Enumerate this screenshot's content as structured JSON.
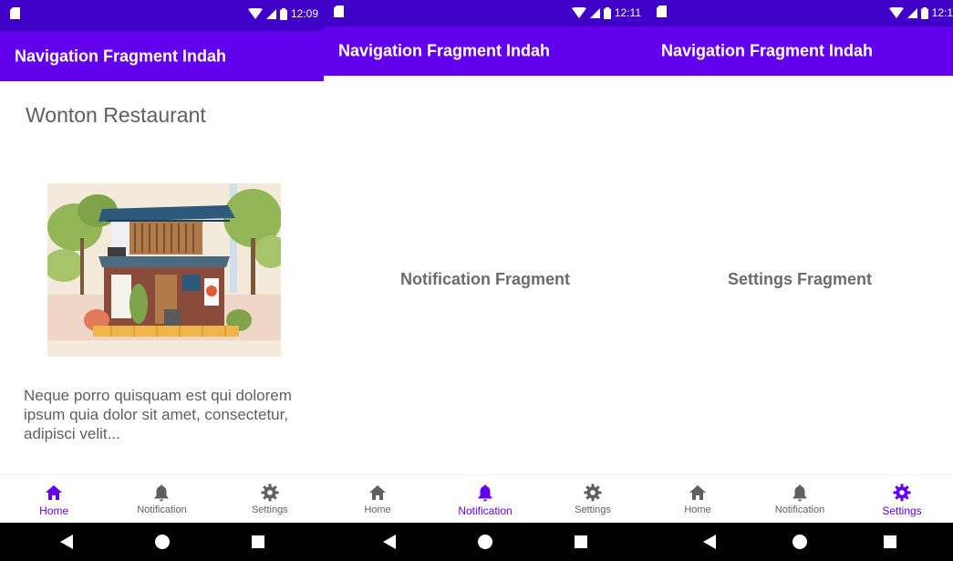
{
  "colors": {
    "status_bar": "#3f00c8",
    "app_bar": "#6200ee",
    "active_nav": "#6200ee",
    "inactive_nav": "#5f5f5f",
    "text_primary": "#5f5f5f",
    "system_nav": "#000000"
  },
  "screens": [
    {
      "status": {
        "time": "12:09",
        "sim_icon": "sim-card-icon",
        "wifi_icon": "wifi-icon",
        "signal_icon": "signal-icon",
        "battery_icon": "battery-icon"
      },
      "app_title": "Navigation Fragment Indah",
      "content": {
        "title": "Wonton Restaurant",
        "image_icon": "restaurant-illustration",
        "description": "Neque porro quisquam est qui dolorem ipsum quia dolor sit amet, consectetur, adipisci velit..."
      },
      "nav": [
        {
          "label": "Home",
          "icon": "home-icon",
          "active": true
        },
        {
          "label": "Notification",
          "icon": "bell-icon",
          "active": false
        },
        {
          "label": "Settings",
          "icon": "gear-icon",
          "active": false
        }
      ]
    },
    {
      "status": {
        "time": "12:11",
        "sim_icon": "sim-card-icon",
        "wifi_icon": "wifi-icon",
        "signal_icon": "signal-icon",
        "battery_icon": "battery-icon"
      },
      "app_title": "Navigation Fragment Indah",
      "content": {
        "fragment_text": "Notification Fragment"
      },
      "nav": [
        {
          "label": "Home",
          "icon": "home-icon",
          "active": false
        },
        {
          "label": "Notification",
          "icon": "bell-icon",
          "active": true
        },
        {
          "label": "Settings",
          "icon": "gear-icon",
          "active": false
        }
      ]
    },
    {
      "status": {
        "time": "12:1",
        "sim_icon": "sim-card-icon",
        "wifi_icon": "wifi-icon",
        "signal_icon": "signal-icon",
        "battery_icon": "battery-icon"
      },
      "app_title": "Navigation Fragment Indah",
      "content": {
        "fragment_text": "Settings Fragment"
      },
      "nav": [
        {
          "label": "Home",
          "icon": "home-icon",
          "active": false
        },
        {
          "label": "Notification",
          "icon": "bell-icon",
          "active": false
        },
        {
          "label": "Settings",
          "icon": "gear-icon",
          "active": true
        }
      ]
    }
  ],
  "system_nav": {
    "back_icon": "back-triangle-icon",
    "home_icon": "home-circle-icon",
    "recents_icon": "recents-square-icon"
  }
}
